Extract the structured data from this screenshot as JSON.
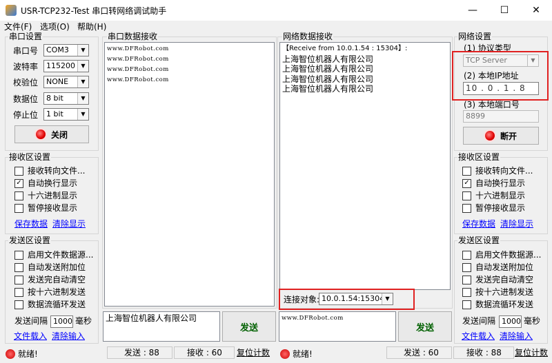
{
  "window": {
    "title": "USR-TCP232-Test 串口转网络调试助手",
    "min": "—",
    "max": "☐",
    "close": "✕"
  },
  "menu": [
    "文件(F)",
    "选项(O)",
    "帮助(H)"
  ],
  "serial_settings": {
    "title": "串口设置",
    "port_label": "串口号",
    "port_value": "COM3",
    "baud_label": "波特率",
    "baud_value": "115200",
    "parity_label": "校验位",
    "parity_value": "NONE",
    "data_label": "数据位",
    "data_value": "8 bit",
    "stop_label": "停止位",
    "stop_value": "1 bit",
    "button": "关闭"
  },
  "left_receive": {
    "title": "接收区设置",
    "options": [
      {
        "label": "接收转向文件...",
        "checked": false
      },
      {
        "label": "自动换行显示",
        "checked": true
      },
      {
        "label": "十六进制显示",
        "checked": false
      },
      {
        "label": "暂停接收显示",
        "checked": false
      }
    ],
    "save": "保存数据",
    "clear": "清除显示"
  },
  "left_send": {
    "title": "发送区设置",
    "options": [
      {
        "label": "启用文件数据源...",
        "checked": false
      },
      {
        "label": "自动发送附加位",
        "checked": false
      },
      {
        "label": "发送完自动清空",
        "checked": false
      },
      {
        "label": "按十六进制发送",
        "checked": false
      },
      {
        "label": "数据流循环发送",
        "checked": false
      }
    ],
    "interval_label": "发送间隔",
    "interval_value": "1000",
    "unit": "毫秒",
    "load": "文件载入",
    "clear": "清除输入"
  },
  "serial_recv": {
    "title": "串口数据接收",
    "lines": [
      "www.DFRobot.com",
      "www.DFRobot.com",
      "www.DFRobot.com",
      "www.DFRobot.com"
    ]
  },
  "net_recv": {
    "title": "网络数据接收",
    "header": "【Receive from 10.0.1.54 : 15304】:",
    "lines": [
      "上海智位机器人有限公司",
      "上海智位机器人有限公司",
      "上海智位机器人有限公司",
      "上海智位机器人有限公司"
    ]
  },
  "connection": {
    "label": "连接对象:",
    "value": "10.0.1.54:15304"
  },
  "serial_send": {
    "text": "上海智位机器人有限公司",
    "button": "发送"
  },
  "net_send": {
    "text": "www.DFRobot.com",
    "button": "发送"
  },
  "net_settings": {
    "title": "网络设置",
    "protocol_label": "(1) 协议类型",
    "protocol_value": "TCP Server",
    "ip_label": "(2) 本地IP地址",
    "ip_parts": [
      "10",
      "0",
      "1",
      "8"
    ],
    "ip_dot": ".",
    "port_label": "(3) 本地端口号",
    "port_value": "8899",
    "button": "断开"
  },
  "right_receive": {
    "title": "接收区设置",
    "options": [
      {
        "label": "接收转向文件...",
        "checked": false
      },
      {
        "label": "自动换行显示",
        "checked": true
      },
      {
        "label": "十六进制显示",
        "checked": false
      },
      {
        "label": "暂停接收显示",
        "checked": false
      }
    ],
    "save": "保存数据",
    "clear": "清除显示"
  },
  "right_send": {
    "title": "发送区设置",
    "options": [
      {
        "label": "启用文件数据源...",
        "checked": false
      },
      {
        "label": "自动发送附加位",
        "checked": false
      },
      {
        "label": "发送完自动清空",
        "checked": false
      },
      {
        "label": "按十六进制发送",
        "checked": false
      },
      {
        "label": "数据流循环发送",
        "checked": false
      }
    ],
    "interval_label": "发送间隔",
    "interval_value": "1000",
    "unit": "毫秒",
    "load": "文件载入",
    "clear": "清除输入"
  },
  "status_left": {
    "ready": "就绪!",
    "sent": "发送 : 88",
    "recv": "接收 : 60",
    "reset": "复位计数"
  },
  "status_right": {
    "ready": "就绪!",
    "sent": "发送 : 60",
    "recv": "接收 : 88",
    "reset": "复位计数"
  }
}
